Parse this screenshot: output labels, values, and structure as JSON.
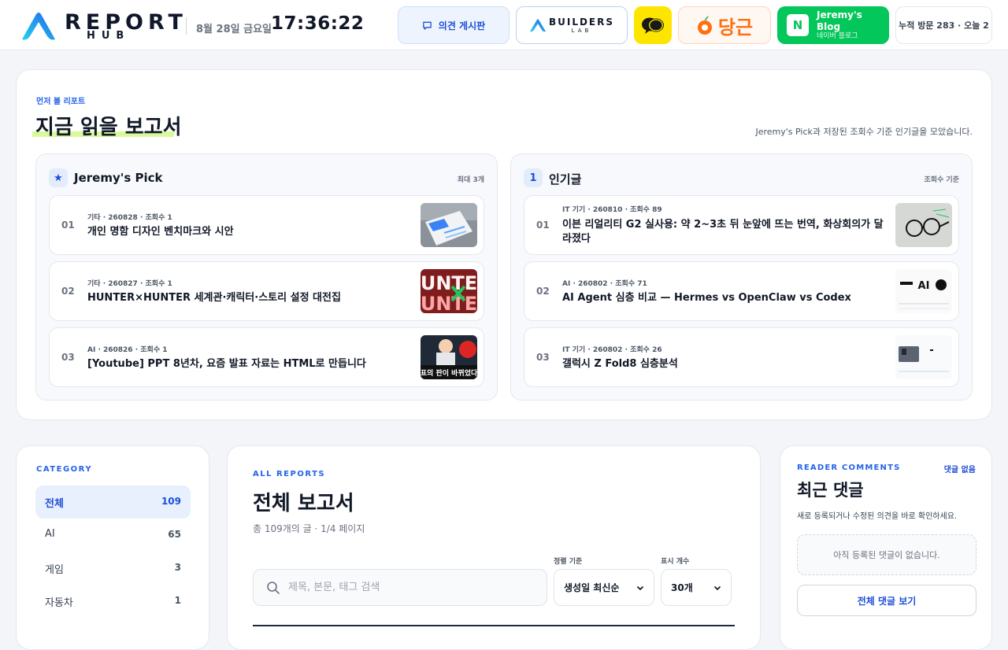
{
  "header": {
    "logo_line1": "REPORT",
    "logo_line2": "HUB",
    "date": "8월 28일 금요일",
    "time": "17:36:22",
    "board_label": "의견 게시판",
    "builders_label": "BUILDERS",
    "builders_sub": "LAB",
    "daangn_label": "당근",
    "blog_title": "Jeremy's Blog",
    "blog_sub": "네이버 블로그",
    "blog_letter": "N",
    "visits": "누적 방문 283 · 오늘 2"
  },
  "featured": {
    "eyebrow": "먼저 볼 리포트",
    "title": "지금 읽을 보고서",
    "subtitle": "Jeremy's Pick과 저장된 조회수 기준 인기글을 모았습니다.",
    "picks": {
      "badge": "★",
      "title": "Jeremy's Pick",
      "note": "최대 3개",
      "items": [
        {
          "num": "01",
          "meta": "기타 · 260828 · 조회수 1",
          "title": "개인 명함 디자인 벤치마크와 시안"
        },
        {
          "num": "02",
          "meta": "기타 · 260827 · 조회수 1",
          "title": "HUNTER×HUNTER 세계관·캐릭터·스토리 설정 대전집"
        },
        {
          "num": "03",
          "meta": "AI · 260826 · 조회수 1",
          "title": "[Youtube] PPT 8년차, 요즘 발표 자료는 HTML로 만듭니다"
        }
      ]
    },
    "popular": {
      "badge": "1",
      "title": "인기글",
      "note": "조회수 기준",
      "items": [
        {
          "num": "01",
          "meta": "IT 기기 · 260810 · 조회수 89",
          "title": "이븐 리얼리티 G2 실사용: 약 2~3초 뒤 눈앞에 뜨는 번역, 화상회의가 달라졌다"
        },
        {
          "num": "02",
          "meta": "AI · 260802 · 조회수 71",
          "title": "AI Agent 심층 비교 — Hermes vs OpenClaw vs Codex"
        },
        {
          "num": "03",
          "meta": "IT 기기 · 260802 · 조회수 26",
          "title": "갤럭시 Z Fold8 심층분석"
        }
      ]
    }
  },
  "thumbs": {
    "hunter_top": "UNTE",
    "hunter_bottom": "UNTE",
    "youtube_caption": "표의 판이 바뀌었다",
    "ai_logo": "AI"
  },
  "category": {
    "eyebrow": "CATEGORY",
    "items": [
      {
        "label": "전체",
        "count": "109"
      },
      {
        "label": "AI",
        "count": "65"
      },
      {
        "label": "게임",
        "count": "3"
      },
      {
        "label": "자동차",
        "count": "1"
      }
    ]
  },
  "reports": {
    "eyebrow": "ALL REPORTS",
    "title": "전체 보고서",
    "subtitle": "총 109개의 글 · 1/4 페이지",
    "search_placeholder": "제목, 본문, 태그 검색",
    "sort_label": "정렬 기준",
    "sort_value": "생성일 최신순",
    "count_label": "표시 개수",
    "count_value": "30개"
  },
  "comments": {
    "eyebrow": "READER COMMENTS",
    "status": "댓글 없음",
    "title": "최근 댓글",
    "subtitle": "새로 등록되거나 수정된 의견을 바로 확인하세요.",
    "empty": "아직 등록된 댓글이 없습니다.",
    "view_all": "전체 댓글 보기"
  },
  "colors": {
    "accent": "#2563eb",
    "highlight": "#d9f99d",
    "kakao": "#fee500",
    "daangn": "#ff6f0f",
    "naver": "#03c75a"
  }
}
